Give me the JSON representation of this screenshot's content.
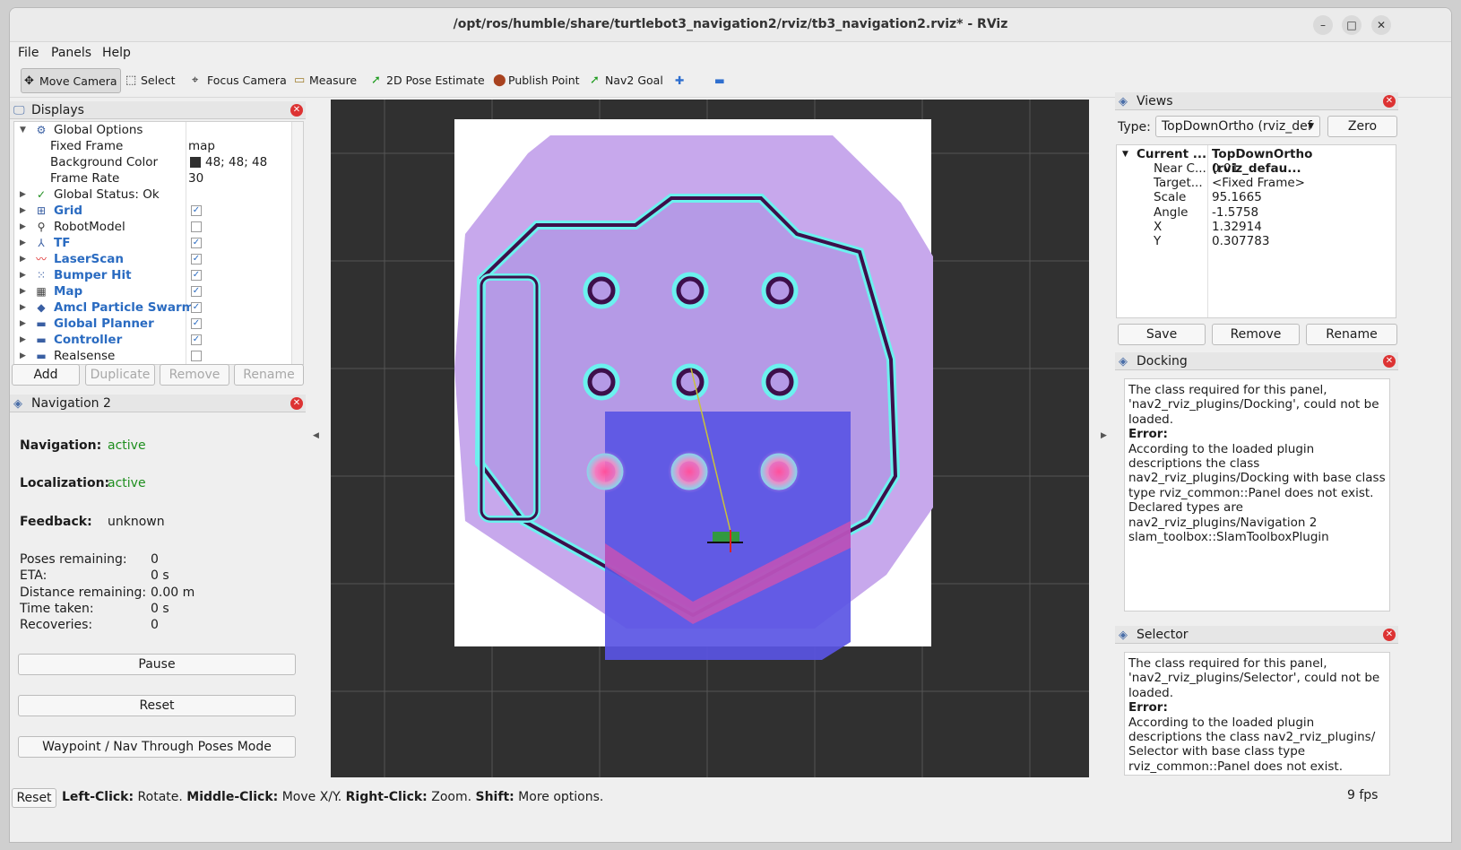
{
  "window": {
    "title": "/opt/ros/humble/share/turtlebot3_navigation2/rviz/tb3_navigation2.rviz* - RViz",
    "controls": [
      "–",
      "□",
      "✕"
    ]
  },
  "menu": [
    "File",
    "Panels",
    "Help"
  ],
  "toolbar": {
    "tools": [
      {
        "label": "Move Camera",
        "icon": "move-camera-icon"
      },
      {
        "label": "Select",
        "icon": "select-icon"
      },
      {
        "label": "Focus Camera",
        "icon": "focus-camera-icon"
      },
      {
        "label": "Measure",
        "icon": "measure-icon"
      },
      {
        "label": "2D Pose Estimate",
        "icon": "pose-estimate-icon"
      },
      {
        "label": "Publish Point",
        "icon": "publish-point-icon"
      },
      {
        "label": "Nav2 Goal",
        "icon": "nav2-goal-icon"
      }
    ],
    "plus": "✚",
    "minus": "▬"
  },
  "displays": {
    "title": "Displays",
    "rows": [
      {
        "label": "Global Options",
        "value": ""
      },
      {
        "label": "Fixed Frame",
        "value": "map"
      },
      {
        "label": "Background Color",
        "value": "48; 48; 48"
      },
      {
        "label": "Frame Rate",
        "value": "30"
      },
      {
        "label": "Global Status: Ok",
        "value": ""
      },
      {
        "label": "Grid",
        "checked": "✓"
      },
      {
        "label": "RobotModel",
        "checked": ""
      },
      {
        "label": "TF",
        "checked": "✓"
      },
      {
        "label": "LaserScan",
        "checked": "✓"
      },
      {
        "label": "Bumper Hit",
        "checked": "✓"
      },
      {
        "label": "Map",
        "checked": "✓"
      },
      {
        "label": "Amcl Particle Swarm",
        "checked": "✓"
      },
      {
        "label": "Global Planner",
        "checked": "✓"
      },
      {
        "label": "Controller",
        "checked": "✓"
      },
      {
        "label": "Realsense",
        "checked": ""
      }
    ],
    "buttons": [
      "Add",
      "Duplicate",
      "Remove",
      "Rename"
    ]
  },
  "nav2": {
    "title": "Navigation 2",
    "navigation_label": "Navigation:",
    "navigation_value": "active",
    "localization_label": "Localization:",
    "localization_value": "active",
    "feedback_label": "Feedback:",
    "feedback_value": "unknown",
    "stats": [
      {
        "label": "Poses remaining:",
        "value": "0"
      },
      {
        "label": "ETA:",
        "value": "0 s"
      },
      {
        "label": "Distance remaining:",
        "value": "0.00 m"
      },
      {
        "label": "Time taken:",
        "value": "0 s"
      },
      {
        "label": "Recoveries:",
        "value": "0"
      }
    ],
    "buttons": [
      "Pause",
      "Reset",
      "Waypoint / Nav Through Poses Mode"
    ]
  },
  "views": {
    "title": "Views",
    "type_label": "Type:",
    "type_value": "TopDownOrtho (rviz_def",
    "zero": "Zero",
    "rows": [
      {
        "k": "Current ...",
        "v": "TopDownOrtho (rviz_defau..."
      },
      {
        "k": "Near C...",
        "v": "0.01"
      },
      {
        "k": "Target...",
        "v": "<Fixed Frame>"
      },
      {
        "k": "Scale",
        "v": "95.1665"
      },
      {
        "k": "Angle",
        "v": "-1.5758"
      },
      {
        "k": "X",
        "v": "1.32914"
      },
      {
        "k": "Y",
        "v": "0.307783"
      }
    ],
    "buttons": [
      "Save",
      "Remove",
      "Rename"
    ]
  },
  "docking": {
    "title": "Docking",
    "line1": "The class required for this panel, 'nav2_rviz_plugins/Docking', could not be loaded.",
    "error_label": "Error:",
    "line2": "According to the loaded plugin descriptions the class nav2_rviz_plugins/Docking with base class type rviz_common::Panel does not exist. Declared types are nav2_rviz_plugins/Navigation 2 slam_toolbox::SlamToolboxPlugin"
  },
  "selector": {
    "title": "Selector",
    "line1": "The class required for this panel, 'nav2_rviz_plugins/Selector', could not be loaded.",
    "error_label": "Error:",
    "line2": "According to the loaded plugin descriptions the class nav2_rviz_plugins/ Selector with base class type rviz_common::Panel does not exist."
  },
  "status": {
    "reset": "Reset",
    "hint_left_b": "Left-Click:",
    "hint_left": " Rotate. ",
    "hint_mid_b": "Middle-Click:",
    "hint_mid": " Move X/Y. ",
    "hint_right_b": "Right-Click:",
    "hint_right": " Zoom. ",
    "hint_shift_b": "Shift:",
    "hint_shift": " More options.",
    "fps": "9 fps"
  }
}
